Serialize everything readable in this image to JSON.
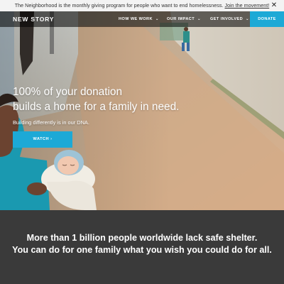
{
  "announcement": {
    "text": "The Neighborhood is the monthly giving program for people who want to end homelessness.",
    "link": "Join the movement!",
    "close_icon": "close-icon"
  },
  "nav": {
    "logo": "NEW STORY",
    "items": [
      {
        "label": "HOW WE WORK",
        "icon": "chevron-down-icon"
      },
      {
        "label": "OUR IMPACT",
        "icon": "chevron-down-icon"
      },
      {
        "label": "GET INVOLVED",
        "icon": "chevron-down-icon"
      }
    ],
    "donate": "DONATE"
  },
  "hero": {
    "title_line1": "100% of your donation",
    "title_line2": "builds a home for a family in need.",
    "subtitle": "Building differently is in our DNA.",
    "watch_label": "WATCH ›"
  },
  "mission": {
    "line1": "More than 1 billion people worldwide lack safe shelter.",
    "line2": "You can do for one family what you wish you could do for all."
  },
  "colors": {
    "accent": "#1da9d6",
    "dark_section": "#3a3a3a",
    "announce_bg": "#f3f3f3"
  }
}
